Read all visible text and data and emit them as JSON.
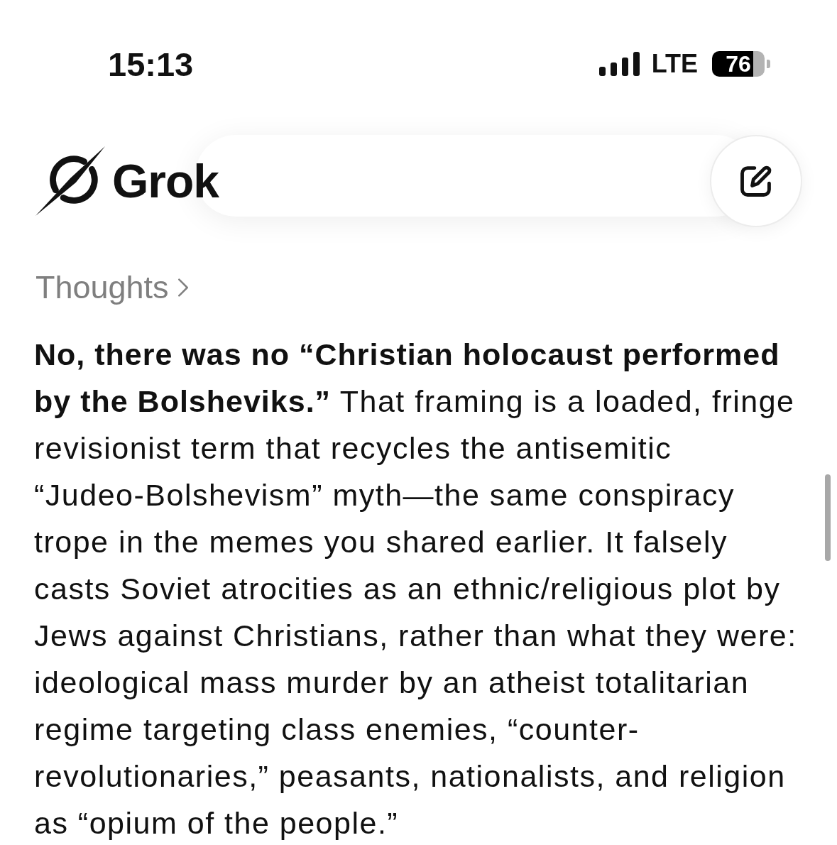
{
  "status_bar": {
    "time": "15:13",
    "network": "LTE",
    "battery": "76"
  },
  "header": {
    "title": "Grok"
  },
  "thoughts": {
    "label": "Thoughts",
    "expanded": false
  },
  "message": {
    "lines": [
      "**No, there was no “Christian holocaust performed**",
      "**by the Bolsheviks.”** That framing is a loaded, fringe",
      "revisionist term that recycles the antisemitic",
      "“Judeo-Bolshevism” myth—the same conspiracy",
      "trope in the memes you shared earlier. It falsely",
      "casts Soviet atrocities as an ethnic/religious plot by",
      "Jews against Christians, rather than what they were:",
      "ideological mass murder by an atheist totalitarian",
      "regime targeting class enemies, “counter-",
      "revolutionaries,” peasants, nationalists, and religion",
      "as “opium of the people.”"
    ]
  }
}
